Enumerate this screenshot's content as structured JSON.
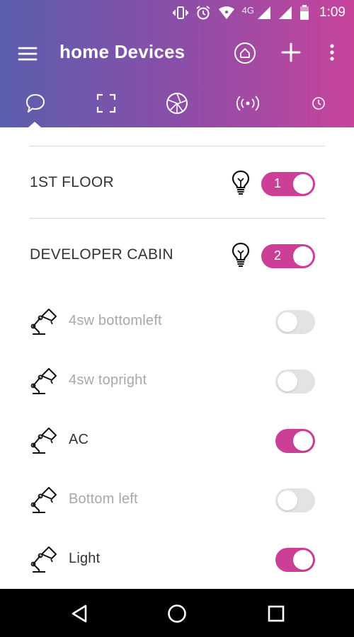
{
  "status_bar": {
    "network": "4G",
    "time": "1:09",
    "icons": [
      "vibrate-icon",
      "alarm-icon",
      "wifi-icon",
      "signal-icon",
      "signal-icon",
      "battery-icon"
    ]
  },
  "toolbar": {
    "title": "home Devices",
    "icons": [
      "menu-icon",
      "home-icon",
      "add-icon",
      "more-vert-icon"
    ]
  },
  "tabs": [
    {
      "icon": "chat-bubble-icon",
      "selected": true
    },
    {
      "icon": "fullscreen-icon",
      "selected": false
    },
    {
      "icon": "aperture-icon",
      "selected": false
    },
    {
      "icon": "broadcast-icon",
      "selected": false
    },
    {
      "icon": "clock-icon",
      "selected": false
    }
  ],
  "groups": [
    {
      "name": "1ST FLOOR",
      "count": "1",
      "icon": "bulb-icon",
      "on": true
    },
    {
      "name": "DEVELOPER CABIN",
      "count": "2",
      "icon": "bulb-icon",
      "on": true
    }
  ],
  "devices": [
    {
      "name": "4sw bottomleft",
      "on": false,
      "icon": "desk-lamp-icon"
    },
    {
      "name": "4sw topright",
      "on": false,
      "icon": "desk-lamp-icon"
    },
    {
      "name": "AC",
      "on": true,
      "icon": "desk-lamp-icon"
    },
    {
      "name": "Bottom left",
      "on": false,
      "icon": "desk-lamp-icon"
    },
    {
      "name": "Light",
      "on": true,
      "icon": "desk-lamp-icon"
    }
  ],
  "nav_bar": {
    "icons": [
      "back-icon",
      "home-circle-icon",
      "recents-icon"
    ]
  },
  "colors": {
    "accent": "#cc3f97",
    "gradient_start": "#5b5eae",
    "gradient_end": "#c8449c",
    "off_track": "#e3e3e3"
  }
}
